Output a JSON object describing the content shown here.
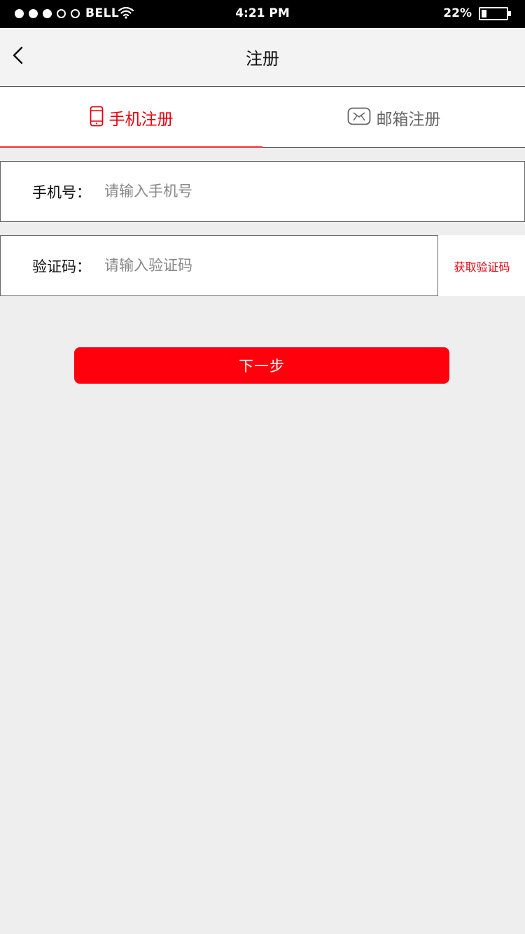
{
  "status_bar": {
    "carrier": "BELL",
    "time": "4:21 PM",
    "battery_percent_text": "22%",
    "battery_level": 0.22,
    "signal_dots": [
      true,
      true,
      true,
      false,
      false
    ]
  },
  "nav": {
    "title": "注册",
    "back_icon": "chevron-left-icon"
  },
  "tabs": [
    {
      "label": "手机注册",
      "icon": "phone-icon",
      "active": true
    },
    {
      "label": "邮箱注册",
      "icon": "mail-icon",
      "active": false
    }
  ],
  "form": {
    "phone_label": "手机号：",
    "phone_placeholder": "请输入手机号",
    "phone_value": "",
    "code_label": "验证码：",
    "code_placeholder": "请输入验证码",
    "code_value": "",
    "get_code_label": "获取验证码"
  },
  "next_label": "下一步",
  "colors": {
    "accent": "#e8000b",
    "button": "#ff000c",
    "background": "#eeeeee"
  }
}
